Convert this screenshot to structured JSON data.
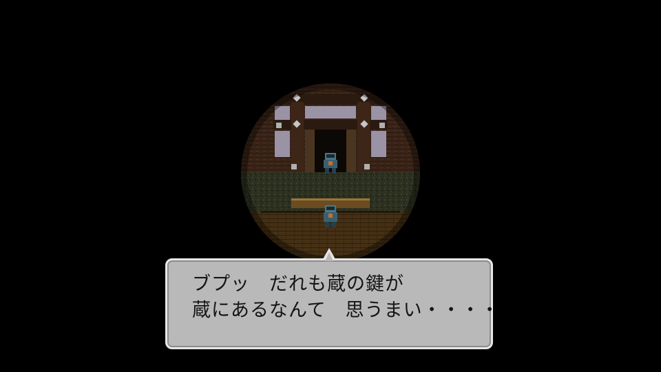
{
  "scene": {
    "name": "storehouse-interior"
  },
  "dialog": {
    "lines": [
      "ブプッ　だれも蔵の鍵が",
      "蔵にあるなんて　思うまい・・・・"
    ]
  },
  "colors": {
    "background": "#000000",
    "dialog_fill": "#b9b9b9",
    "dialog_border": "#e6e6e6",
    "text": "#141414"
  }
}
